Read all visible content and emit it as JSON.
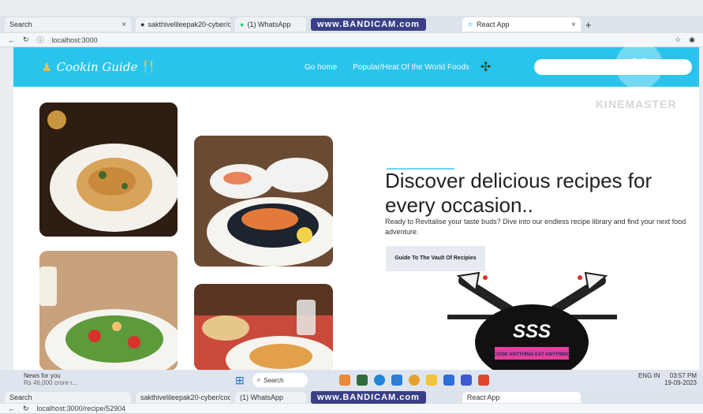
{
  "browser": {
    "tabs": [
      {
        "label": "Search"
      },
      {
        "label": "sakthivelileepak20-cyber/cook"
      },
      {
        "label": "(1) WhatsApp"
      },
      {
        "label": "React App"
      }
    ],
    "bandicam": "www.BANDICAM.com",
    "url": "localhost:3000",
    "url_bottom": "localhost:3000/recipe/52904"
  },
  "site": {
    "brand": "Cookin Guide",
    "nav": [
      {
        "label": "Go home"
      },
      {
        "label": "Popular/Heat Of the World Foods"
      }
    ],
    "search": {
      "placeholder": ""
    }
  },
  "hero": {
    "headline": "Discover delicious recipes for every occasion..",
    "subtext": "Ready to Revitalise your taste buds? Dive into our endless recipe library and find your next food adventure.",
    "cta": "Guide To The Vault Of Recipies"
  },
  "logo": {
    "text": "SSS",
    "tagline": "COOK ANYTHING EAT ANYTHING"
  },
  "overlay": {
    "watermark": "KINEMASTER",
    "badge": "K"
  },
  "taskbar": {
    "news_title": "News for you",
    "news_sub": "Rs 46,000 crore r...",
    "search": "Search",
    "tray_lang": "ENG IN",
    "time": "03:57 PM",
    "date": "19-09-2023"
  },
  "colors": {
    "nav": "#29c4ec",
    "accent": "#6fd4ef"
  }
}
